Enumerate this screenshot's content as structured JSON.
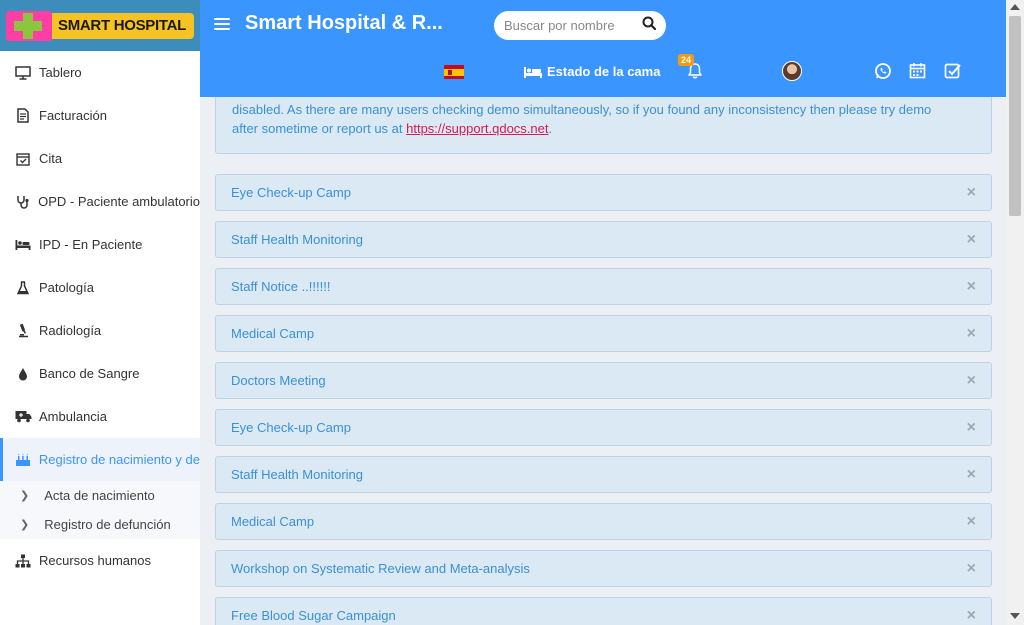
{
  "brand": {
    "logo_text": "SMART HOSPITAL"
  },
  "header": {
    "title": "Smart Hospital & R...",
    "search_placeholder": "Buscar por nombre",
    "bed_status_label": "Estado de la cama",
    "whatsapp_badge": "24",
    "icons": [
      "menu-icon",
      "search-icon",
      "spain-flag-icon",
      "bell-icon",
      "bed-icon",
      "whatsapp-icon",
      "calendar-icon",
      "task-check-icon",
      "user-avatar"
    ]
  },
  "sidebar": {
    "items": [
      {
        "label": "Tablero",
        "icon": "monitor-icon"
      },
      {
        "label": "Facturación",
        "icon": "invoice-icon"
      },
      {
        "label": "Cita",
        "icon": "calendar-check-icon"
      },
      {
        "label": "OPD - Paciente ambulatorio",
        "icon": "stethoscope-icon"
      },
      {
        "label": "IPD - En Paciente",
        "icon": "bed-icon"
      },
      {
        "label": "Patología",
        "icon": "flask-icon"
      },
      {
        "label": "Radiología",
        "icon": "microscope-icon"
      },
      {
        "label": "Banco de Sangre",
        "icon": "blood-drop-icon"
      },
      {
        "label": "Ambulancia",
        "icon": "ambulance-icon"
      },
      {
        "label": "Registro de nacimiento y de",
        "icon": "birthday-cake-icon"
      }
    ],
    "sub_items": [
      {
        "label": "Acta de nacimiento"
      },
      {
        "label": "Registro de defunción"
      }
    ],
    "last_item": {
      "label": "Recursos humanos",
      "icon": "org-chart-icon"
    }
  },
  "notice": {
    "text_line1": "disabled. As there are many users checking demo simultaneously, so if you found any inconsistency then please try demo",
    "text_line2_prefix": "after sometime or report us at ",
    "link_text": "https://support.qdocs.net",
    "text_line2_suffix": "."
  },
  "alerts": [
    {
      "title": "Eye Check-up Camp"
    },
    {
      "title": "Staff Health Monitoring"
    },
    {
      "title": "Staff Notice ..!!!!!!"
    },
    {
      "title": "Medical Camp"
    },
    {
      "title": "Doctors Meeting"
    },
    {
      "title": "Eye Check-up Camp"
    },
    {
      "title": "Staff Health Monitoring"
    },
    {
      "title": "Medical Camp"
    },
    {
      "title": "Workshop on Systematic Review and Meta-analysis"
    },
    {
      "title": "Free Blood Sugar Campaign"
    }
  ],
  "alert_close_glyph": "×",
  "colors": {
    "primary": "#3b95ff",
    "alert_bg": "#dbe9f4",
    "alert_text": "#3a90d6",
    "link": "#d61a54"
  }
}
